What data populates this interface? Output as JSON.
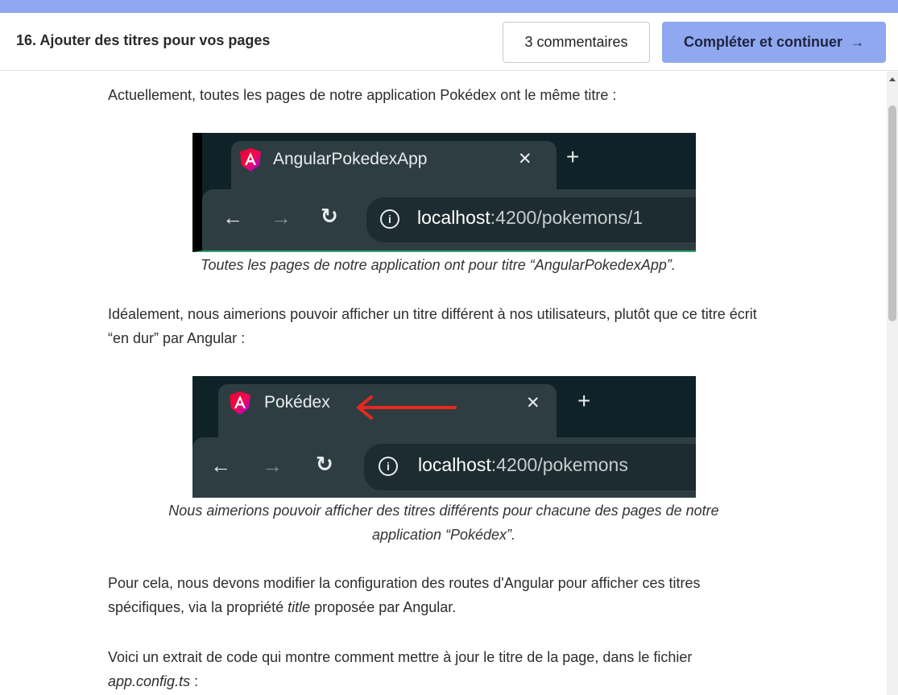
{
  "header": {
    "lesson_title": "16. Ajouter des titres pour vos pages",
    "comments_label": "3 commentaires",
    "complete_label": "Compléter et continuer",
    "complete_arrow": "→"
  },
  "content": {
    "p1": "Actuellement, toutes les pages de notre application Pokédex ont le même titre :",
    "screenshot1": {
      "tab_title": "AngularPokedexApp",
      "close": "✕",
      "new_tab": "+",
      "back": "←",
      "forward": "→",
      "reload": "↻",
      "info": "i",
      "url_host": "localhost",
      "url_rest": ":4200/pokemons/1"
    },
    "caption1": "Toutes les pages de notre application ont pour titre “AngularPokedexApp”.",
    "p2": "Idéalement, nous aimerions pouvoir afficher un titre différent à nos utilisateurs, plutôt que ce titre écrit “en dur” par Angular :",
    "screenshot2": {
      "tab_title": "Pokédex",
      "close": "✕",
      "new_tab": "+",
      "back": "←",
      "forward": "→",
      "reload": "↻",
      "info": "i",
      "url_host": "localhost",
      "url_rest": ":4200/pokemons"
    },
    "caption2": "Nous aimerions pouvoir afficher des titres différents pour chacune des pages de notre application “Pokédex”.",
    "p3_before": "Pour cela, nous devons modifier la configuration des routes d'Angular pour afficher ces titres spécifiques, via la propriété ",
    "p3_em": "title",
    "p3_after": " proposée par Angular.",
    "p4_before": "Voici un extrait de code qui montre comment mettre à jour le titre de la page, dans le fichier ",
    "p4_em": "app.config.ts",
    "p4_after": " :"
  },
  "colors": {
    "accent": "#8fa8ef",
    "top_strip": "#90a8ef",
    "browser_dark": "#0f2227",
    "browser_tab": "#2e3d42",
    "annotation_arrow": "#e8281e"
  },
  "icons": [
    "angular-logo-icon",
    "close-icon",
    "plus-icon",
    "back-arrow-icon",
    "forward-arrow-icon",
    "reload-icon",
    "info-icon",
    "red-arrow-annotation",
    "scroll-up-icon"
  ]
}
